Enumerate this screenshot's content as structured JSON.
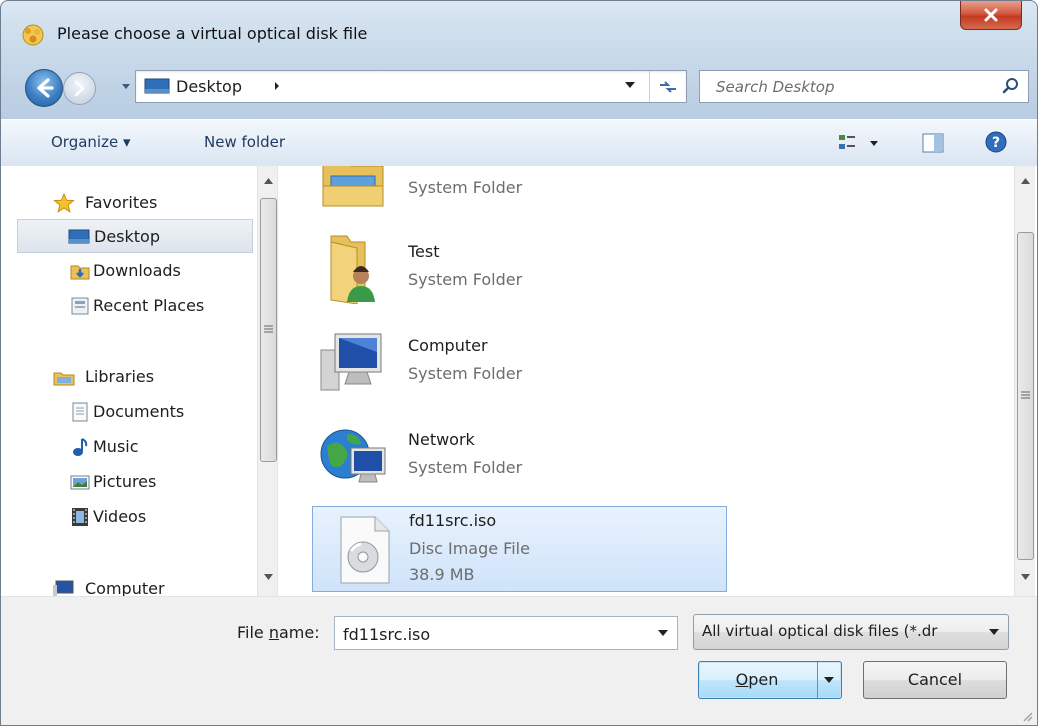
{
  "window": {
    "title": "Please choose a virtual optical disk file",
    "close_label": "X"
  },
  "navbar": {
    "address": "Desktop",
    "search_placeholder": "Search Desktop"
  },
  "toolbar": {
    "organize": "Organize ▾",
    "new_folder": "New folder"
  },
  "nav_pane": {
    "items": [
      {
        "label": "Favorites",
        "icon": "star-icon"
      },
      {
        "label": "Desktop",
        "icon": "desktop-icon",
        "selected": true
      },
      {
        "label": "Downloads",
        "icon": "downloads-icon"
      },
      {
        "label": "Recent Places",
        "icon": "recent-places-icon"
      },
      {
        "label": "Libraries",
        "icon": "libraries-icon"
      },
      {
        "label": "Documents",
        "icon": "documents-icon"
      },
      {
        "label": "Music",
        "icon": "music-icon"
      },
      {
        "label": "Pictures",
        "icon": "pictures-icon"
      },
      {
        "label": "Videos",
        "icon": "videos-icon"
      },
      {
        "label": "Computer",
        "icon": "computer-icon"
      }
    ]
  },
  "files": [
    {
      "name": "",
      "desc": "System Folder",
      "icon": "folder-icon"
    },
    {
      "name": "Test",
      "desc": "System Folder",
      "icon": "user-folder-icon"
    },
    {
      "name": "Computer",
      "desc": "System Folder",
      "icon": "computer-icon"
    },
    {
      "name": "Network",
      "desc": "System Folder",
      "icon": "network-icon"
    },
    {
      "name": "fd11src.iso",
      "desc": "Disc Image File",
      "size": "38.9 MB",
      "icon": "disc-image-icon",
      "selected": true
    }
  ],
  "bottom": {
    "file_name_label_pre": "File ",
    "file_name_label_u": "n",
    "file_name_label_post": "ame:",
    "file_name_value": "fd11src.iso",
    "filter": "All virtual optical disk files (*.dr",
    "open_u": "O",
    "open_rest": "pen",
    "cancel": "Cancel"
  },
  "colors": {
    "selection": "#cfe3fa",
    "title_bar": "#dbe7f3",
    "close_button": "#c23b21"
  }
}
